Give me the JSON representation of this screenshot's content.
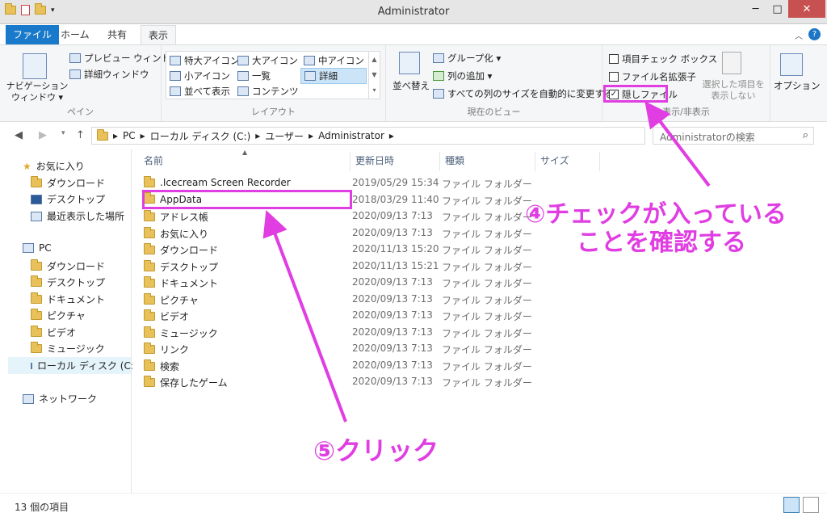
{
  "window": {
    "title": "Administrator",
    "min": "─",
    "max": "□",
    "close": "✕"
  },
  "tabs": {
    "file": "ファイル",
    "home": "ホーム",
    "share": "共有",
    "view": "表示"
  },
  "ribbon": {
    "pane": {
      "nav_pane": "ナビゲーション\nウィンドウ ▾",
      "preview": "プレビュー ウィンドウ",
      "details": "詳細ウィンドウ",
      "label": "ペイン"
    },
    "layout": {
      "xl_icons": "特大アイコン",
      "large_icons": "大アイコン",
      "medium_icons": "中アイコン",
      "small_icons": "小アイコン",
      "list": "一覧",
      "details": "詳細",
      "tiles": "並べて表示",
      "content": "コンテンツ",
      "label": "レイアウト"
    },
    "current_view": {
      "sort": "並べ替え",
      "group": "グループ化 ▾",
      "add_col": "列の追加 ▾",
      "fit_cols": "すべての列のサイズを自動的に変更する",
      "label": "現在のビュー"
    },
    "show_hide": {
      "item_check": "項目チェック ボックス",
      "ext": "ファイル名拡張子",
      "hidden": "隠しファイル",
      "hide_selected": "選択した項目を\n表示しない",
      "label": "表示/非表示"
    },
    "options": "オプション"
  },
  "address": {
    "segments": [
      "PC",
      "ローカル ディスク (C:)",
      "ユーザー",
      "Administrator"
    ],
    "search_placeholder": "Administratorの検索"
  },
  "nav": {
    "favorites": "お気に入り",
    "downloads": "ダウンロード",
    "desktop": "デスクトップ",
    "recent": "最近表示した場所",
    "pc": "PC",
    "pc_downloads": "ダウンロード",
    "pc_desktop": "デスクトップ",
    "documents": "ドキュメント",
    "pictures": "ピクチャ",
    "videos": "ビデオ",
    "music": "ミュージック",
    "local_disk": "ローカル ディスク (C:)",
    "network": "ネットワーク"
  },
  "columns": {
    "name": "名前",
    "date": "更新日時",
    "type": "種類",
    "size": "サイズ"
  },
  "files": [
    {
      "name": ".Icecream Screen Recorder",
      "date": "2019/05/29 15:34",
      "type": "ファイル フォルダー"
    },
    {
      "name": "AppData",
      "date": "2018/03/29 11:40",
      "type": "ファイル フォルダー"
    },
    {
      "name": "アドレス帳",
      "date": "2020/09/13 7:13",
      "type": "ファイル フォルダー"
    },
    {
      "name": "お気に入り",
      "date": "2020/09/13 7:13",
      "type": "ファイル フォルダー"
    },
    {
      "name": "ダウンロード",
      "date": "2020/11/13 15:20",
      "type": "ファイル フォルダー"
    },
    {
      "name": "デスクトップ",
      "date": "2020/11/13 15:21",
      "type": "ファイル フォルダー"
    },
    {
      "name": "ドキュメント",
      "date": "2020/09/13 7:13",
      "type": "ファイル フォルダー"
    },
    {
      "name": "ピクチャ",
      "date": "2020/09/13 7:13",
      "type": "ファイル フォルダー"
    },
    {
      "name": "ビデオ",
      "date": "2020/09/13 7:13",
      "type": "ファイル フォルダー"
    },
    {
      "name": "ミュージック",
      "date": "2020/09/13 7:13",
      "type": "ファイル フォルダー"
    },
    {
      "name": "リンク",
      "date": "2020/09/13 7:13",
      "type": "ファイル フォルダー"
    },
    {
      "name": "検索",
      "date": "2020/09/13 7:13",
      "type": "ファイル フォルダー"
    },
    {
      "name": "保存したゲーム",
      "date": "2020/09/13 7:13",
      "type": "ファイル フォルダー"
    }
  ],
  "status": {
    "count": "13 個の項目"
  },
  "annotations": {
    "step4_line1": "④チェックが入っている",
    "step4_line2": "ことを確認する",
    "step5": "⑤クリック",
    "color": "#e03de2"
  }
}
